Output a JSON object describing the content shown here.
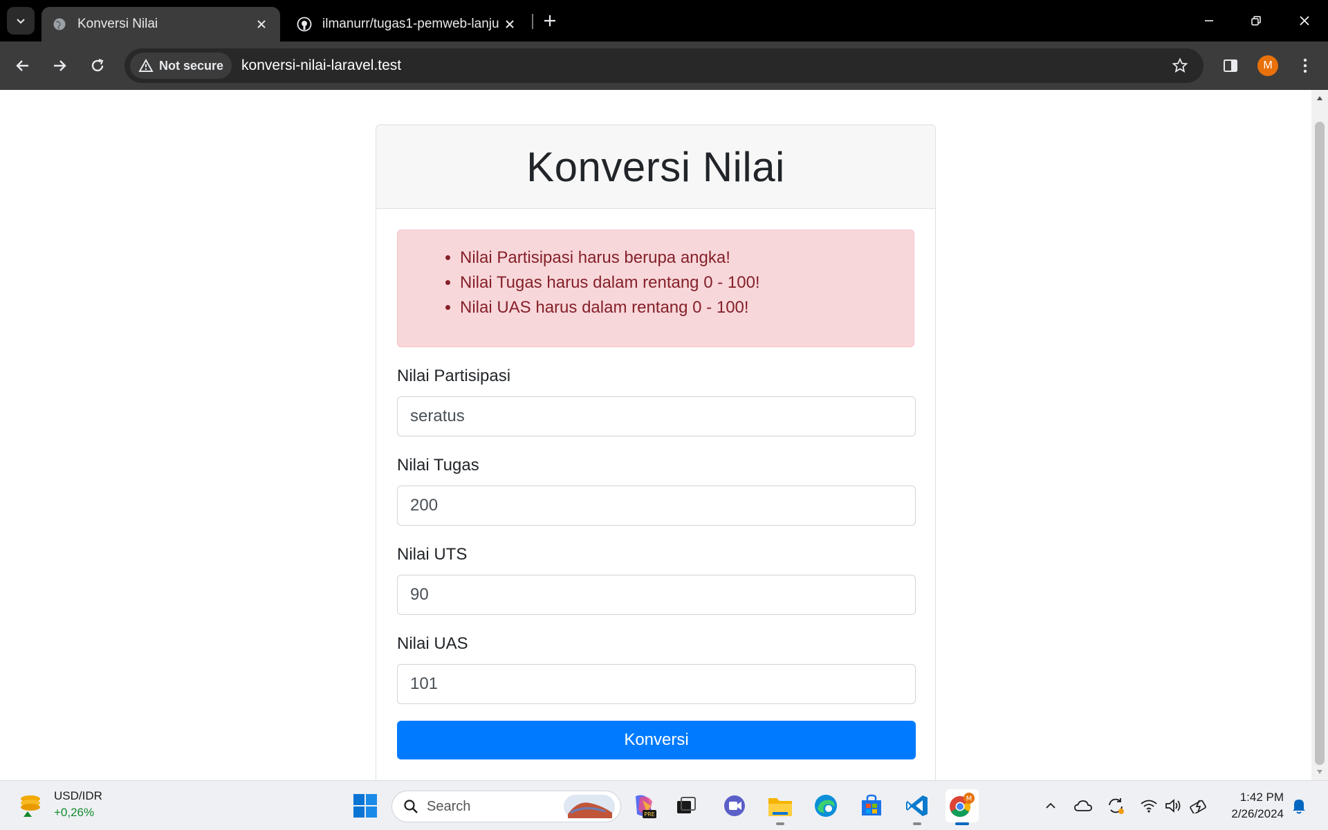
{
  "browser": {
    "tabs": [
      {
        "title": "Konversi Nilai",
        "active": true
      },
      {
        "title": "ilmanurr/tugas1-pemweb-lanjut",
        "active": false
      }
    ],
    "security_label": "Not secure",
    "url": "konversi-nilai-laravel.test",
    "profile_initial": "M"
  },
  "page": {
    "title": "Konversi Nilai",
    "errors": [
      "Nilai Partisipasi harus berupa angka!",
      "Nilai Tugas harus dalam rentang 0 - 100!",
      "Nilai UAS harus dalam rentang 0 - 100!"
    ],
    "fields": [
      {
        "label": "Nilai Partisipasi",
        "value": "seratus"
      },
      {
        "label": "Nilai Tugas",
        "value": "200"
      },
      {
        "label": "Nilai UTS",
        "value": "90"
      },
      {
        "label": "Nilai UAS",
        "value": "101"
      }
    ],
    "submit_label": "Konversi"
  },
  "taskbar": {
    "widget": {
      "title": "USD/IDR",
      "change": "+0,26%"
    },
    "search_label": "Search",
    "time": "1:42 PM",
    "date": "2/26/2024",
    "copilot_badge": "PRE",
    "chrome_badge": "M"
  },
  "colors": {
    "primary": "#007bff",
    "alert_bg": "#f8d7da",
    "alert_text": "#842029",
    "avatar": "#e8710a"
  }
}
